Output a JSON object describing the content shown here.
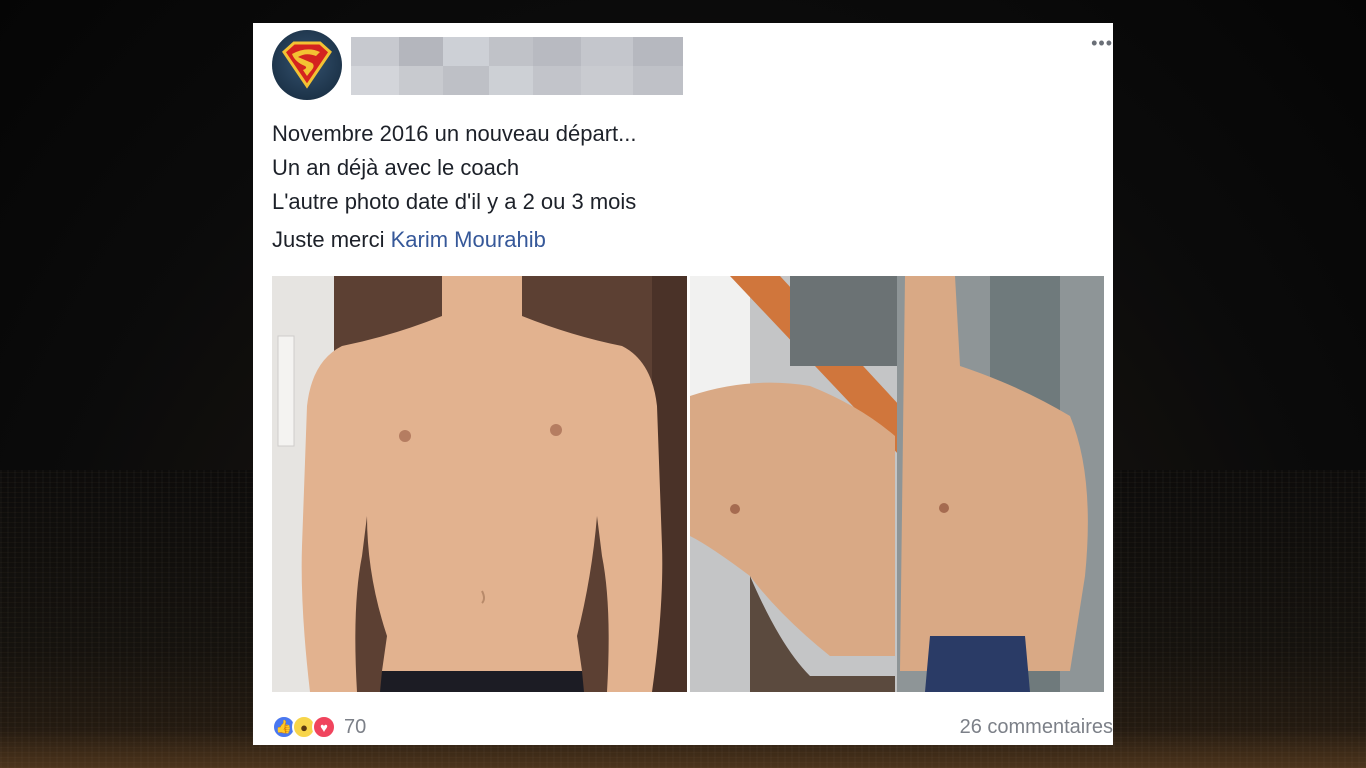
{
  "post": {
    "more_label": "•••",
    "lines": [
      "Novembre 2016 un nouveau départ...",
      "Un an déjà avec le coach",
      "L'autre photo date d'il y a 2 ou 3 mois"
    ],
    "thanks_text": "Juste merci",
    "thanks_link": "Karim Mourahib"
  },
  "footer": {
    "reaction_icons": [
      "like-icon",
      "wow-icon",
      "love-icon"
    ],
    "reaction_count": "70",
    "comments": "26 commentaires"
  },
  "colors": {
    "link": "#365899",
    "muted": "#7c8088",
    "like": "#4a78f0",
    "love": "#f0445d",
    "wow": "#f7d54a"
  }
}
